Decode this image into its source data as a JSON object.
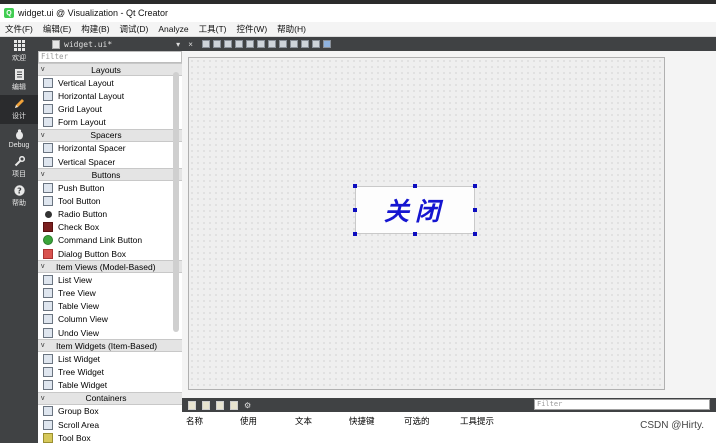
{
  "window": {
    "title": "widget.ui @ Visualization - Qt Creator"
  },
  "menu": [
    "文件(F)",
    "编辑(E)",
    "构建(B)",
    "调试(D)",
    "Analyze",
    "工具(T)",
    "控件(W)",
    "帮助(H)"
  ],
  "modes": [
    {
      "label": "欢迎",
      "icon": "welcome-grid-icon"
    },
    {
      "label": "编辑",
      "icon": "edit-document-icon"
    },
    {
      "label": "设计",
      "icon": "design-pencil-icon",
      "active": true
    },
    {
      "label": "Debug",
      "icon": "debug-bug-icon"
    },
    {
      "label": "项目",
      "icon": "project-wrench-icon"
    },
    {
      "label": "帮助",
      "icon": "help-question-icon"
    }
  ],
  "editor": {
    "document_tab": "widget.ui*",
    "tab_arrow": "▾",
    "close_symbol": "×"
  },
  "widgetbox": {
    "filter_placeholder": "Filter",
    "layouts": {
      "title": "Layouts",
      "items": [
        "Vertical Layout",
        "Horizontal Layout",
        "Grid Layout",
        "Form Layout"
      ]
    },
    "spacers": {
      "title": "Spacers",
      "items": [
        "Horizontal Spacer",
        "Vertical Spacer"
      ]
    },
    "buttons": {
      "title": "Buttons",
      "items": [
        "Push Button",
        "Tool Button",
        "Radio Button",
        "Check Box",
        "Command Link Button",
        "Dialog Button Box"
      ]
    },
    "item_views": {
      "title": "Item Views (Model-Based)",
      "items": [
        "List View",
        "Tree View",
        "Table View",
        "Column View",
        "Undo View"
      ]
    },
    "item_widgets": {
      "title": "Item Widgets (Item-Based)",
      "items": [
        "List Widget",
        "Tree Widget",
        "Table Widget"
      ]
    },
    "containers": {
      "title": "Containers",
      "items": [
        "Group Box",
        "Scroll Area",
        "Tool Box"
      ]
    }
  },
  "form": {
    "button_text": "关闭"
  },
  "action_editor": {
    "filter_placeholder": "Filter",
    "columns": [
      "名称",
      "使用",
      "文本",
      "快捷键",
      "可选的",
      "工具提示"
    ]
  },
  "watermark": "CSDN @Hirty."
}
